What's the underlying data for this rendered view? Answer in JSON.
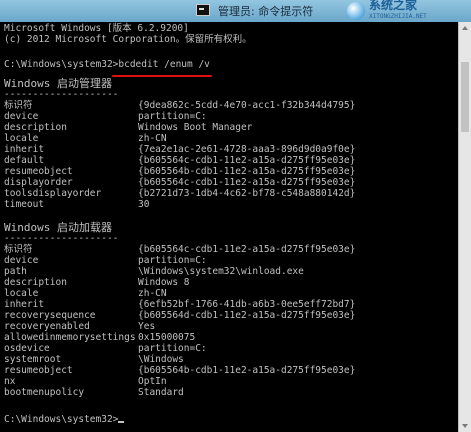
{
  "window": {
    "title": "管理员: 命令提示符",
    "watermark_text": "系统之家",
    "watermark_sub": "XITONGZHIJIA.NET"
  },
  "console": {
    "header": [
      "Microsoft Windows [版本 6.2.9200]",
      "(c) 2012 Microsoft Corporation。保留所有权利。"
    ],
    "prompt": "C:\\Windows\\system32>",
    "command": "bcdedit /enum /v",
    "boot_manager": {
      "heading": "Windows 启动管理器",
      "separator": "--------------------",
      "entries": [
        {
          "key": "标识符",
          "value": "{9dea862c-5cdd-4e70-acc1-f32b344d4795}"
        },
        {
          "key": "device",
          "value": "partition=C:"
        },
        {
          "key": "description",
          "value": "Windows Boot Manager"
        },
        {
          "key": "locale",
          "value": "zh-CN"
        },
        {
          "key": "inherit",
          "value": "{7ea2e1ac-2e61-4728-aaa3-896d9d0a9f0e}"
        },
        {
          "key": "default",
          "value": "{b605564c-cdb1-11e2-a15a-d275ff95e03e}"
        },
        {
          "key": "resumeobject",
          "value": "{b605564b-cdb1-11e2-a15a-d275ff95e03e}"
        },
        {
          "key": "displayorder",
          "value": "{b605564c-cdb1-11e2-a15a-d275ff95e03e}"
        },
        {
          "key": "toolsdisplayorder",
          "value": "{b2721d73-1db4-4c62-bf78-c548a880142d}"
        },
        {
          "key": "timeout",
          "value": "30"
        }
      ]
    },
    "boot_loader": {
      "heading": "Windows 启动加载器",
      "separator": "--------------------",
      "entries": [
        {
          "key": "标识符",
          "value": "{b605564c-cdb1-11e2-a15a-d275ff95e03e}"
        },
        {
          "key": "device",
          "value": "partition=C:"
        },
        {
          "key": "path",
          "value": "\\Windows\\system32\\winload.exe"
        },
        {
          "key": "description",
          "value": "Windows 8"
        },
        {
          "key": "locale",
          "value": "zh-CN"
        },
        {
          "key": "inherit",
          "value": "{6efb52bf-1766-41db-a6b3-0ee5eff72bd7}"
        },
        {
          "key": "recoverysequence",
          "value": "{b605564d-cdb1-11e2-a15a-d275ff95e03e}"
        },
        {
          "key": "recoveryenabled",
          "value": "Yes"
        },
        {
          "key": "allowedinmemorysettings",
          "value": "0x15000075"
        },
        {
          "key": "osdevice",
          "value": "partition=C:"
        },
        {
          "key": "systemroot",
          "value": "\\Windows"
        },
        {
          "key": "resumeobject",
          "value": "{b605564b-cdb1-11e2-a15a-d275ff95e03e}"
        },
        {
          "key": "nx",
          "value": "OptIn"
        },
        {
          "key": "bootmenupolicy",
          "value": "Standard"
        }
      ]
    },
    "final_prompt": "C:\\Windows\\system32>"
  },
  "colors": {
    "console_bg": "#000000",
    "console_fg": "#c0c0c0",
    "highlight": "#e01010"
  }
}
